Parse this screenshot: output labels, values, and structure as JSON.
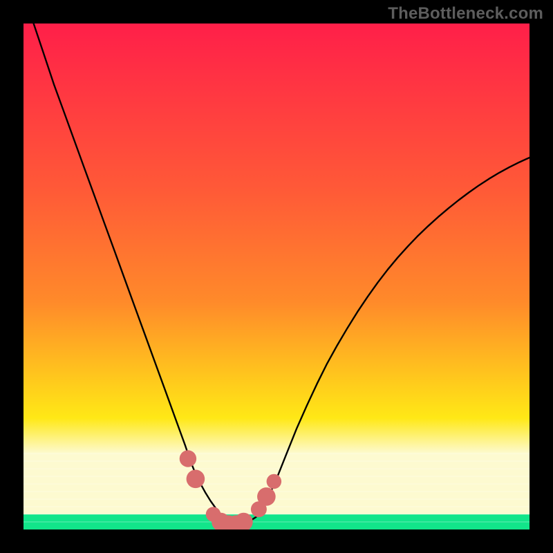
{
  "attribution": "TheBottleneck.com",
  "colors": {
    "red": "#ff1f49",
    "orange": "#ff8a2a",
    "yellow": "#ffe816",
    "pale": "#fdfad0",
    "green": "#12e58a",
    "black": "#000000",
    "curve": "#000000",
    "markers": "#d86d6d"
  },
  "chart_data": {
    "type": "line",
    "title": "",
    "xlabel": "",
    "ylabel": "",
    "xlim": [
      0,
      100
    ],
    "ylim": [
      0,
      100
    ],
    "x": [
      2,
      4,
      6,
      8,
      10,
      12,
      14,
      16,
      18,
      20,
      22,
      24,
      26,
      28,
      30,
      32,
      33,
      34,
      35,
      36,
      37,
      38,
      39,
      40,
      41,
      42,
      43,
      44,
      46,
      48,
      50,
      52,
      54,
      56,
      58,
      60,
      62,
      64,
      66,
      68,
      70,
      72,
      74,
      76,
      78,
      80,
      82,
      84,
      86,
      88,
      90,
      92,
      94,
      96,
      98,
      100
    ],
    "values": [
      100,
      94,
      88,
      82.5,
      77,
      71.5,
      66,
      60.5,
      55,
      49.5,
      44,
      38.5,
      33,
      27.5,
      22,
      16.5,
      13.5,
      11,
      9,
      7.2,
      5.6,
      4.2,
      3,
      2,
      1.3,
      1,
      1,
      1.2,
      2.5,
      5.5,
      10,
      15,
      20,
      24.5,
      28.8,
      32.8,
      36.4,
      39.8,
      43,
      46,
      48.8,
      51.4,
      53.8,
      56,
      58.1,
      60,
      61.8,
      63.5,
      65.1,
      66.6,
      68,
      69.3,
      70.5,
      71.6,
      72.6,
      73.5
    ],
    "markers": {
      "x": [
        32.5,
        34,
        37.5,
        39,
        40.5,
        42,
        43.5,
        46.5,
        48,
        49.5
      ],
      "y": [
        14,
        10,
        3,
        1.5,
        1,
        1,
        1.5,
        4,
        6.5,
        9.5
      ],
      "r": [
        1.7,
        2.0,
        1.3,
        2.0,
        2.0,
        2.0,
        2.0,
        1.5,
        2.0,
        1.3
      ]
    },
    "green_band": {
      "y0": 0,
      "y1": 3
    },
    "pale_band": {
      "y0": 3,
      "y1": 15
    }
  }
}
